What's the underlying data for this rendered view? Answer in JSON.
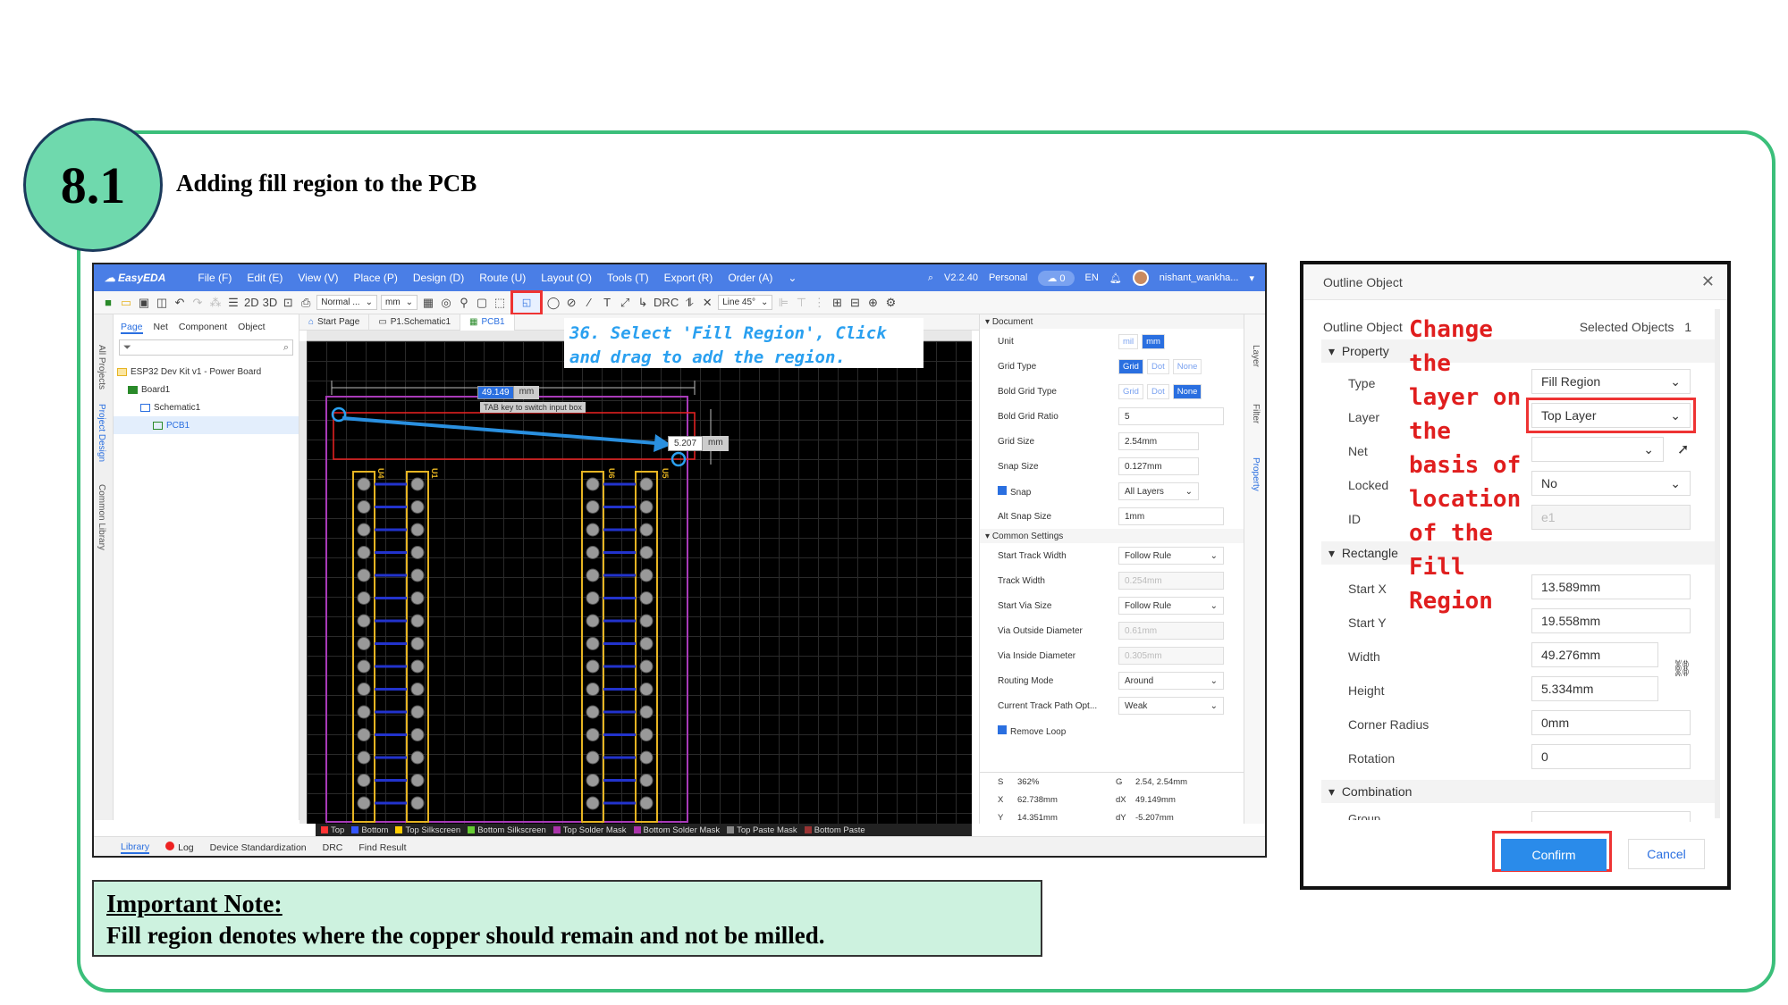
{
  "step": {
    "number": "8.1",
    "title": "Adding fill region to the PCB"
  },
  "app": {
    "logo": "EasyEDA",
    "menu": [
      "File (F)",
      "Edit (E)",
      "View (V)",
      "Place (P)",
      "Design (D)",
      "Route (U)",
      "Layout (O)",
      "Tools (T)",
      "Export (R)",
      "Order (A)"
    ],
    "version": "V2.2.40",
    "plan": "Personal",
    "cloud_count": "0",
    "language": "EN",
    "user": "nishant_wankha..."
  },
  "toolbar": {
    "view_2d": "2D",
    "view_3d": "3D",
    "mode": "Normal ...",
    "unit": "mm",
    "drc": "DRC",
    "line_mode": "Line 45°"
  },
  "left_tabs": {
    "all_projects": "All Projects",
    "project_design": "Project Design",
    "common_library": "Common Library"
  },
  "left_panel": {
    "tabs": [
      "Page",
      "Net",
      "Component",
      "Object"
    ],
    "tree": [
      "ESP32 Dev Kit v1 - Power Board",
      "Board1",
      "Schematic1",
      "PCB1"
    ]
  },
  "doc_tabs": [
    "Start Page",
    "P1.Schematic1",
    "PCB1"
  ],
  "callout": "36. Select 'Fill Region', Click and drag to add the region.",
  "canvas": {
    "width_input": "49.149",
    "width_unit": "mm",
    "tab_hint": "TAB key to switch input box",
    "height_input": "5.207",
    "height_unit": "mm",
    "labels": [
      "U4",
      "U1",
      "U6",
      "U5"
    ]
  },
  "layers": [
    "Top",
    "Bottom",
    "Top Silkscreen",
    "Bottom Silkscreen",
    "Top Solder Mask",
    "Bottom Solder Mask",
    "Top Paste Mask",
    "Bottom Paste"
  ],
  "layer_colors": [
    "#ff3333",
    "#3355ff",
    "#ffcc00",
    "#66cc33",
    "#aa33aa",
    "#aa33aa",
    "#888888",
    "#993333"
  ],
  "bottom_tabs": [
    "Library",
    "Log",
    "Device Standardization",
    "DRC",
    "Find Result"
  ],
  "right_panel": {
    "document_header": "Document",
    "unit_label": "Unit",
    "unit_opts": [
      "mil",
      "mm"
    ],
    "grid_type_label": "Grid Type",
    "grid_type_opts": [
      "Grid",
      "Dot",
      "None"
    ],
    "bold_grid_type_label": "Bold Grid Type",
    "bold_grid_type_opts": [
      "Grid",
      "Dot",
      "None"
    ],
    "bold_grid_ratio_label": "Bold Grid Ratio",
    "bold_grid_ratio": "5",
    "grid_size_label": "Grid Size",
    "grid_size": "2.54mm",
    "snap_size_label": "Snap Size",
    "snap_size": "0.127mm",
    "snap_label": "Snap",
    "snap_value": "All Layers",
    "alt_snap_label": "Alt Snap Size",
    "alt_snap": "1mm",
    "common_header": "Common Settings",
    "start_track_width_label": "Start Track Width",
    "start_track_width": "Follow Rule",
    "track_width_label": "Track Width",
    "track_width": "0.254mm",
    "start_via_size_label": "Start Via Size",
    "start_via_size": "Follow Rule",
    "via_outside_label": "Via Outside Diameter",
    "via_outside": "0.61mm",
    "via_inside_label": "Via Inside Diameter",
    "via_inside": "0.305mm",
    "routing_mode_label": "Routing Mode",
    "routing_mode": "Around",
    "track_path_label": "Current Track Path Opt...",
    "track_path": "Weak",
    "remove_loop_label": "Remove Loop",
    "status": {
      "s": "362%",
      "g": "2.54, 2.54mm",
      "x": "62.738mm",
      "dx": "49.149mm",
      "y": "14.351mm",
      "dy": "-5.207mm"
    }
  },
  "right_tabs": [
    "Layer",
    "Filter",
    "Property"
  ],
  "dialog": {
    "title": "Outline Object",
    "object_label": "Outline Object",
    "selected_label": "Selected Objects",
    "selected_count": "1",
    "property_header": "Property",
    "type_label": "Type",
    "type_value": "Fill Region",
    "layer_label": "Layer",
    "layer_value": "Top Layer",
    "net_label": "Net",
    "net_value": "",
    "locked_label": "Locked",
    "locked_value": "No",
    "id_label": "ID",
    "id_value": "e1",
    "rectangle_header": "Rectangle",
    "start_x_label": "Start X",
    "start_x": "13.589mm",
    "start_y_label": "Start Y",
    "start_y": "19.558mm",
    "width_label": "Width",
    "width": "49.276mm",
    "height_label": "Height",
    "height": "5.334mm",
    "corner_radius_label": "Corner Radius",
    "corner_radius": "0mm",
    "rotation_label": "Rotation",
    "rotation": "0",
    "combination_header": "Combination",
    "group_label": "Group",
    "confirm": "Confirm",
    "cancel": "Cancel"
  },
  "annotation": "Change the layer on the basis of location of the Fill Region",
  "note": {
    "title": "Important Note:",
    "body": "Fill region denotes where the copper should remain and not be milled."
  }
}
